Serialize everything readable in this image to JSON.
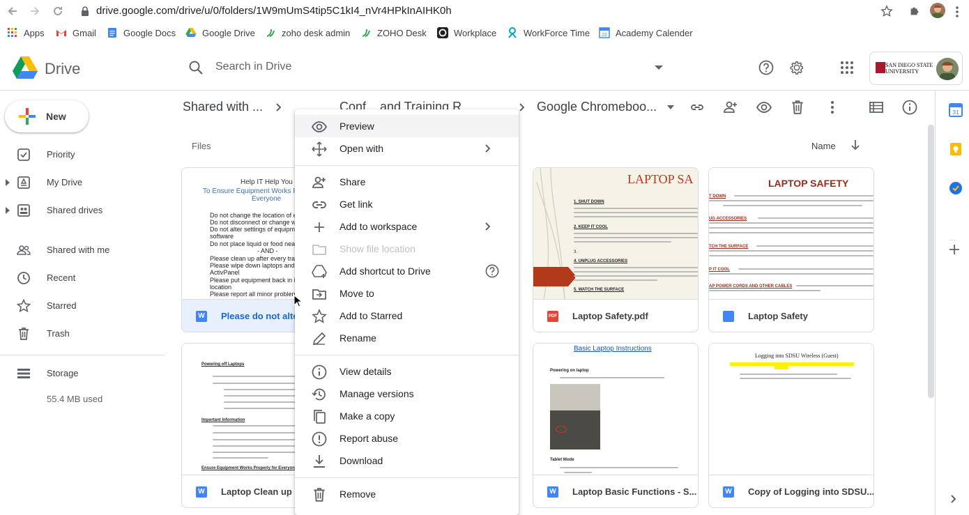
{
  "browser": {
    "url": "drive.google.com/drive/u/0/folders/1W9mUmS4tip5C1kI4_nVr4HPkInAIHK0h",
    "bookmarks": [
      {
        "label": "Apps",
        "icon": "apps-grid-icon"
      },
      {
        "label": "Gmail",
        "icon": "gmail-icon"
      },
      {
        "label": "Google Docs",
        "icon": "google-docs-icon"
      },
      {
        "label": "Google Drive",
        "icon": "google-drive-icon"
      },
      {
        "label": "zoho desk admin",
        "icon": "zoho-icon"
      },
      {
        "label": "ZOHO Desk",
        "icon": "zoho-icon"
      },
      {
        "label": "Workplace",
        "icon": "workplace-icon"
      },
      {
        "label": "WorkForce Time",
        "icon": "workforce-icon"
      },
      {
        "label": "Academy Calender",
        "icon": "calendar-icon"
      }
    ]
  },
  "header": {
    "app_name": "Drive",
    "search_placeholder": "Search in Drive",
    "org_logo_text_1": "SAN DIEGO STATE",
    "org_logo_text_2": "UNIVERSITY"
  },
  "sidebar": {
    "new_label": "New",
    "items": [
      {
        "label": "Priority",
        "icon": "priority-checkbox-icon"
      },
      {
        "label": "My Drive",
        "icon": "my-drive-icon"
      },
      {
        "label": "Shared drives",
        "icon": "shared-drives-icon"
      },
      {
        "label": "Shared with me",
        "icon": "people-icon"
      },
      {
        "label": "Recent",
        "icon": "clock-icon"
      },
      {
        "label": "Starred",
        "icon": "star-icon"
      },
      {
        "label": "Trash",
        "icon": "trash-icon"
      }
    ],
    "storage_label": "Storage",
    "storage_used": "55.4 MB used"
  },
  "toolbar": {
    "breadcrumb_root": "Shared with ...",
    "breadcrumb_middle": "Conf... and Training R...",
    "breadcrumb_current": "Google Chromeboo..."
  },
  "main": {
    "section_label": "Files",
    "sort_label": "Name"
  },
  "files": [
    {
      "name": "Please do not alter...",
      "type": "W",
      "color": "#4285f4",
      "preview": {
        "title": "Help IT Help You",
        "subtitle": "To Ensure Equipment Works P",
        "subtitle2": "Everyone",
        "lines": [
          "Do not change the location of e",
          "Do not disconnect or change wi",
          "Do not alter settings of equipme",
          "software",
          "Do not place liquid or food near",
          "- AND -",
          "Please clean up after every trai",
          "Please wipe down laptops and t",
          "ActivPanel",
          "Please put equipment back in it",
          "location",
          "Please report all minor problem"
        ]
      }
    },
    {
      "name": "Laptop Safety.pdf",
      "type": "PDF",
      "color": "#ea4335",
      "preview": {
        "title": "LAPTOP SA",
        "headings": [
          "1. SHUT DOWN",
          "2. KEEP IT COOL",
          "3.",
          "4. UNPLUG ACCESSORIES",
          "5. WATCH THE SURFACE"
        ]
      }
    },
    {
      "name": "Laptop Safety",
      "type": "DOC",
      "color": "#4285f4",
      "preview": {
        "title": "LAPTOP SAFETY",
        "headings": [
          "T DOWN",
          "UG ACCESSORIES",
          "TCH THE SURFACE",
          "P IT COOL",
          "AP POWER CORDS AND OTHER CABLES"
        ]
      }
    },
    {
      "name": "Laptop Clean up (N...",
      "type": "W",
      "color": "#4285f4",
      "preview": {
        "title": "Powering off Laptops",
        "section2": "Important Information",
        "footer": "Ensure Equipment Works Properly for Everyone"
      }
    },
    {
      "name": "Laptop Basic Functions - S...",
      "type": "W",
      "color": "#4285f4",
      "preview": {
        "title": "Basic Laptop Instructions",
        "section1": "Powering on laptop",
        "section2": "Tablet Mode"
      }
    },
    {
      "name": "Copy of Logging into SDSU...",
      "type": "W",
      "color": "#4285f4",
      "preview": {
        "title": "Logging into SDSU Wireless (Guest)"
      }
    }
  ],
  "context_menu": {
    "items": [
      {
        "label": "Preview",
        "icon": "eye-icon"
      },
      {
        "label": "Open with",
        "icon": "open-with-move-icon"
      },
      {
        "label": "Share",
        "icon": "add-person-icon"
      },
      {
        "label": "Get link",
        "icon": "link-icon"
      },
      {
        "label": "Add to workspace",
        "icon": "plus-icon"
      },
      {
        "label": "Show file location",
        "icon": "folder-icon"
      },
      {
        "label": "Add shortcut to Drive",
        "icon": "add-shortcut-icon"
      },
      {
        "label": "Move to",
        "icon": "move-to-folder-icon"
      },
      {
        "label": "Add to Starred",
        "icon": "star-outline-icon"
      },
      {
        "label": "Rename",
        "icon": "pencil-icon"
      },
      {
        "label": "View details",
        "icon": "info-icon"
      },
      {
        "label": "Manage versions",
        "icon": "history-icon"
      },
      {
        "label": "Make a copy",
        "icon": "copy-icon"
      },
      {
        "label": "Report abuse",
        "icon": "report-icon"
      },
      {
        "label": "Download",
        "icon": "download-icon"
      },
      {
        "label": "Remove",
        "icon": "trash-icon"
      }
    ]
  },
  "colors": {
    "accent": "#1a73e8",
    "selected_bg": "#e8f0fe",
    "hover_bg": "#f1f3f4",
    "border": "#dadce0"
  }
}
